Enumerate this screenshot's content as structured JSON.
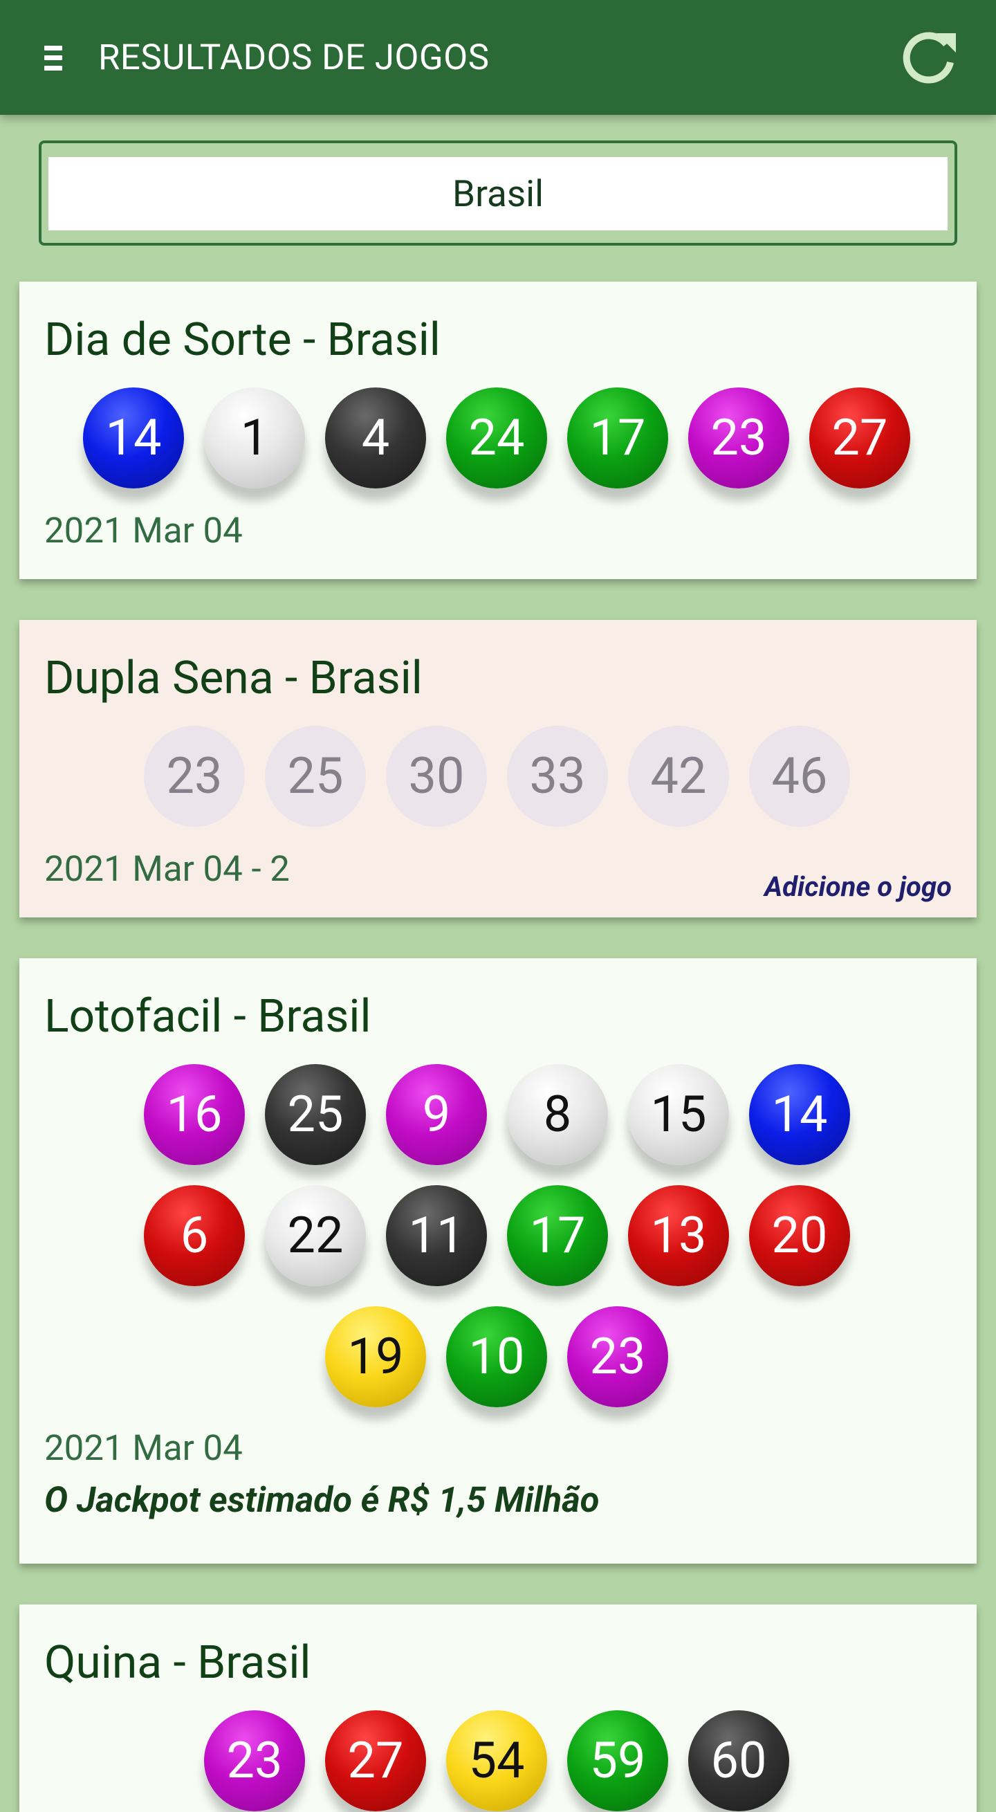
{
  "app": {
    "title": "RESULTADOS DE JOGOS"
  },
  "search": {
    "value": "Brasil"
  },
  "icons": {
    "menu": "menu-icon",
    "refresh": "refresh-icon"
  },
  "colors": {
    "appbar": "#2b6a37",
    "background": "#b3d4a4",
    "card": "#f7fdf5",
    "card_disabled": "#f9ede8",
    "blue_ball": "#0b1ee8",
    "white_ball": "#e8e8e8",
    "black_ball": "#333333",
    "green_ball": "#0aa212",
    "purple_ball": "#c20cc7",
    "red_ball": "#d10c0c",
    "yellow_ball": "#fbd71a"
  },
  "games": [
    {
      "title": "Dia de Sorte - Brasil",
      "date": "2021 Mar 04",
      "balls": [
        {
          "n": "14",
          "color": "blue"
        },
        {
          "n": "1",
          "color": "white"
        },
        {
          "n": "4",
          "color": "black"
        },
        {
          "n": "24",
          "color": "green"
        },
        {
          "n": "17",
          "color": "green"
        },
        {
          "n": "23",
          "color": "purple"
        },
        {
          "n": "27",
          "color": "red"
        }
      ]
    },
    {
      "title": "Dupla Sena - Brasil",
      "date": "2021 Mar 04 - 2",
      "link": "Adicione o jogo",
      "balls": [
        {
          "n": "23",
          "color": "faded"
        },
        {
          "n": "25",
          "color": "faded"
        },
        {
          "n": "30",
          "color": "faded"
        },
        {
          "n": "33",
          "color": "faded"
        },
        {
          "n": "42",
          "color": "faded"
        },
        {
          "n": "46",
          "color": "faded"
        }
      ]
    },
    {
      "title": "Lotofacil - Brasil",
      "date": "2021 Mar 04",
      "jackpot": "O Jackpot estimado é R$ 1,5 Milhão",
      "balls": [
        {
          "n": "16",
          "color": "purple"
        },
        {
          "n": "25",
          "color": "black"
        },
        {
          "n": "9",
          "color": "purple"
        },
        {
          "n": "8",
          "color": "white"
        },
        {
          "n": "15",
          "color": "white"
        },
        {
          "n": "14",
          "color": "blue"
        },
        {
          "n": "6",
          "color": "red"
        },
        {
          "n": "22",
          "color": "white"
        },
        {
          "n": "11",
          "color": "black"
        },
        {
          "n": "17",
          "color": "green"
        },
        {
          "n": "13",
          "color": "red"
        },
        {
          "n": "20",
          "color": "red"
        },
        {
          "n": "19",
          "color": "yellow"
        },
        {
          "n": "10",
          "color": "green"
        },
        {
          "n": "23",
          "color": "purple"
        }
      ]
    },
    {
      "title": "Quina - Brasil",
      "balls": [
        {
          "n": "23",
          "color": "purple"
        },
        {
          "n": "27",
          "color": "red"
        },
        {
          "n": "54",
          "color": "yellow"
        },
        {
          "n": "59",
          "color": "green"
        },
        {
          "n": "60",
          "color": "black"
        }
      ]
    }
  ]
}
